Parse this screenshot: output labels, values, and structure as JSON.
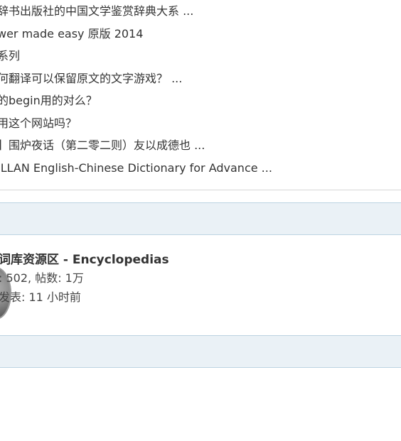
{
  "threads": [
    "辞书出版社的中国文学鉴赏辞典大系 ...",
    "wer made easy 原版 2014",
    "系列",
    "何翻译可以保留原文的文字游戏？ ...",
    "的begin用的对么？",
    "用这个网站吗？",
    "】围炉夜话（第二零二则）友以成德也 ...",
    "ILLAN English-Chinese Dictionary for Advance ..."
  ],
  "forum": {
    "title": "词库资源区 - Encyclopedias",
    "stats": ": 502, 帖数: 1万",
    "last_post": "发表: 11 小时前",
    "icon": "forum-coin-icon"
  },
  "colors": {
    "category_bar_bg": "#eaf1f6",
    "category_bar_border": "#bcd3e2",
    "text": "#333333"
  }
}
